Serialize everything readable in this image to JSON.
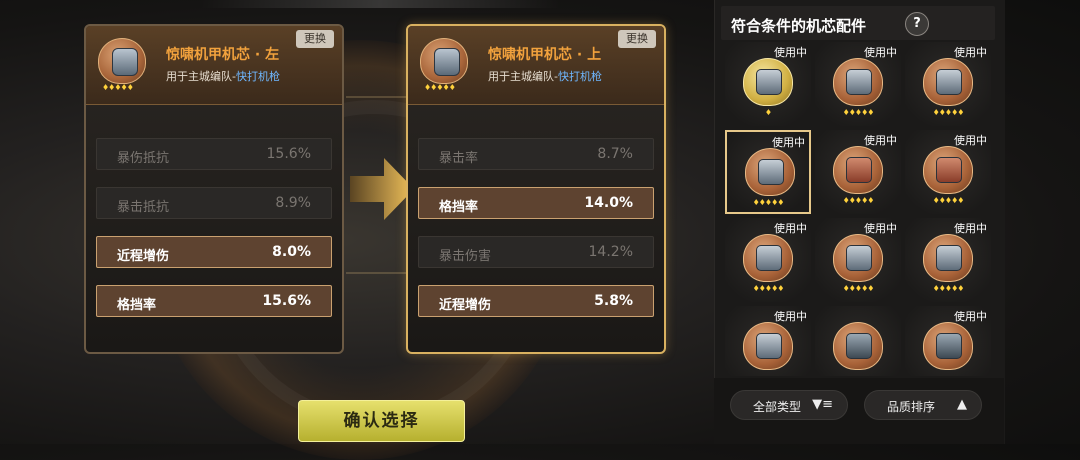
{
  "current_chip": {
    "title": "惊啸机甲机芯 · 左",
    "usage_prefix": "用于主城编队-",
    "usage_unit": "快打机枪",
    "swap_label": "更换",
    "stars": "♦♦♦♦♦",
    "stats": [
      {
        "name": "暴伤抵抗",
        "value": "15.6%",
        "active": false
      },
      {
        "name": "暴击抵抗",
        "value": "8.9%",
        "active": false
      },
      {
        "name": "近程增伤",
        "value": "8.0%",
        "active": true
      },
      {
        "name": "格挡率",
        "value": "15.6%",
        "active": true
      }
    ]
  },
  "new_chip": {
    "title": "惊啸机甲机芯 · 上",
    "usage_prefix": "用于主城编队-",
    "usage_unit": "快打机枪",
    "swap_label": "更换",
    "stars": "♦♦♦♦♦",
    "stats": [
      {
        "name": "暴击率",
        "value": "8.7%",
        "active": false
      },
      {
        "name": "格挡率",
        "value": "14.0%",
        "active": true
      },
      {
        "name": "暴击伤害",
        "value": "14.2%",
        "active": false
      },
      {
        "name": "近程增伤",
        "value": "5.8%",
        "active": true
      }
    ]
  },
  "confirm_label": "确认选择",
  "panel": {
    "title": "符合条件的机芯配件",
    "help": "?",
    "items": [
      {
        "in_use": "使用中",
        "stars": "♦",
        "style": "gold"
      },
      {
        "in_use": "使用中",
        "stars": "♦♦♦♦♦",
        "style": "grey"
      },
      {
        "in_use": "使用中",
        "stars": "♦♦♦♦♦",
        "style": "grey"
      },
      {
        "in_use": "使用中",
        "stars": "♦♦♦♦♦",
        "style": "grey",
        "selected": true
      },
      {
        "in_use": "使用中",
        "stars": "♦♦♦♦♦",
        "style": "red"
      },
      {
        "in_use": "使用中",
        "stars": "♦♦♦♦♦",
        "style": "red"
      },
      {
        "in_use": "使用中",
        "stars": "♦♦♦♦♦",
        "style": "grey"
      },
      {
        "in_use": "使用中",
        "stars": "♦♦♦♦♦",
        "style": "grey"
      },
      {
        "in_use": "使用中",
        "stars": "♦♦♦♦♦",
        "style": "grey"
      },
      {
        "in_use": "使用中",
        "stars": "",
        "style": "grey"
      },
      {
        "in_use": "",
        "stars": "",
        "style": "dark"
      },
      {
        "in_use": "使用中",
        "stars": "",
        "style": "dark"
      }
    ],
    "filter_type": "全部类型",
    "filter_type_icon": "▼≡",
    "sort_label": "品质排序",
    "sort_icon": "▲"
  }
}
